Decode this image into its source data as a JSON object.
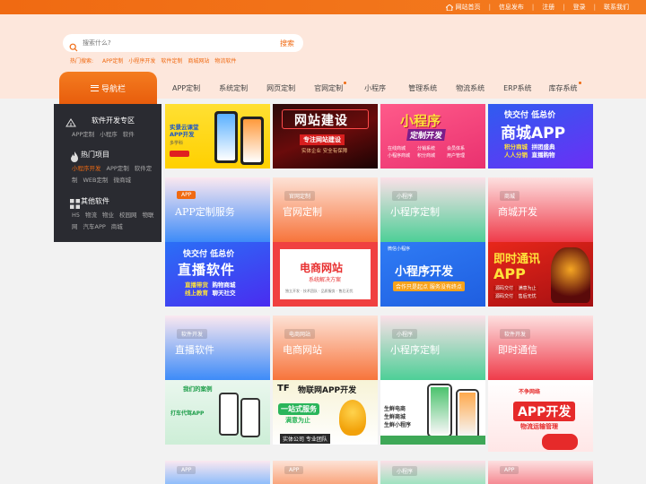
{
  "topbar": {
    "links": [
      "网站首页",
      "信息发布",
      "注册",
      "登录",
      "联系我们"
    ]
  },
  "search": {
    "placeholder": "搜索什么?",
    "button": "搜索"
  },
  "hot": {
    "label": "热门搜索:",
    "words": [
      "APP定制",
      "小程序开发",
      "软件定制",
      "商城网站",
      "物流软件"
    ]
  },
  "nav": {
    "menu_label": "导航栏",
    "items": [
      "APP定制",
      "系统定制",
      "网页定制",
      "官网定制",
      "小程序",
      "管理系统",
      "物流系统",
      "ERP系统",
      "库存系统"
    ]
  },
  "sidebar": {
    "sections": [
      {
        "title": "软件开发专区",
        "links": [
          "APP定制",
          "小程序",
          "软件"
        ]
      },
      {
        "title": "热门项目",
        "links": [
          "小程序开发",
          "APP定制",
          "软件定制",
          "WEB定制",
          "微商城"
        ]
      },
      {
        "title": "其他软件",
        "links": [
          "H5",
          "物流",
          "物业",
          "校园网",
          "物联网",
          "汽车APP",
          "商城"
        ]
      }
    ]
  },
  "cards": [
    {
      "tag": "APP",
      "title": "APP定制服务"
    },
    {
      "tag": "官网定制",
      "title": "官网定制"
    },
    {
      "tag": "小程序",
      "title": "小程序定制"
    },
    {
      "tag": "商城",
      "title": "商城开发"
    },
    {
      "tag": "软件开发",
      "title": "直播软件"
    },
    {
      "tag": "电商网站",
      "title": "电商网站"
    },
    {
      "tag": "小程序",
      "title": "小程序定制"
    },
    {
      "tag": "软件开发",
      "title": "即时通信"
    },
    {
      "tag": "APP",
      "title": ""
    },
    {
      "tag": "APP",
      "title": ""
    },
    {
      "tag": "小程序",
      "title": ""
    },
    {
      "tag": "APP",
      "title": ""
    }
  ],
  "banners": {
    "b1": {
      "title": "实景云课堂 APP开发",
      "sub": "多学科"
    },
    "b2": {
      "title": "网站建设",
      "sub": "专注网站建设",
      "foot": "实体企业 安全有保障"
    },
    "b3": {
      "title": "小程序",
      "sub": "定制开发",
      "items": [
        "在线商城",
        "分销系统",
        "会员体系",
        "小程序商城",
        "积分商城",
        "用户管理"
      ]
    },
    "b4": {
      "top": "快交付 低总价",
      "title": "商城APP",
      "sub1": "积分商城",
      "sub2": "拼团盛典",
      "sub3": "人人分销",
      "sub4": "直播购物"
    },
    "b5": {
      "top": "快交付 低总价",
      "title": "直播软件",
      "s1": "直播带货",
      "s2": "购物商城",
      "s3": "线上教育",
      "s4": "聊天社交"
    },
    "b6": {
      "title": "电商网站",
      "sub": "系统解决方案",
      "foot": "独立开发 · 技术团队 · 品质服务 · 售后无忧"
    },
    "b7": {
      "top": "微信小程序",
      "title": "小程序开发",
      "foot": "合作只是起点 服务没有终点"
    },
    "b8": {
      "title": "即时通讯",
      "sub": "APP",
      "s1": "源码交付",
      "s2": "满意为止",
      "s3": "源码交付",
      "s4": "售后无忧"
    },
    "b9": {
      "title": "我们的案例",
      "sub": "打车代驾APP"
    },
    "b10": {
      "brand": "TF",
      "title": "物联网APP开发",
      "sub1": "一站式服务",
      "sub2": "满意为止",
      "foot": "实体公司 专业团队"
    },
    "b11": {
      "l1": "生鲜电商",
      "l2": "生鲜商城",
      "l3": "生鲜小程序"
    },
    "b12": {
      "brand": "不争网络",
      "title": "APP开发",
      "sub": "物流运输管理"
    }
  }
}
